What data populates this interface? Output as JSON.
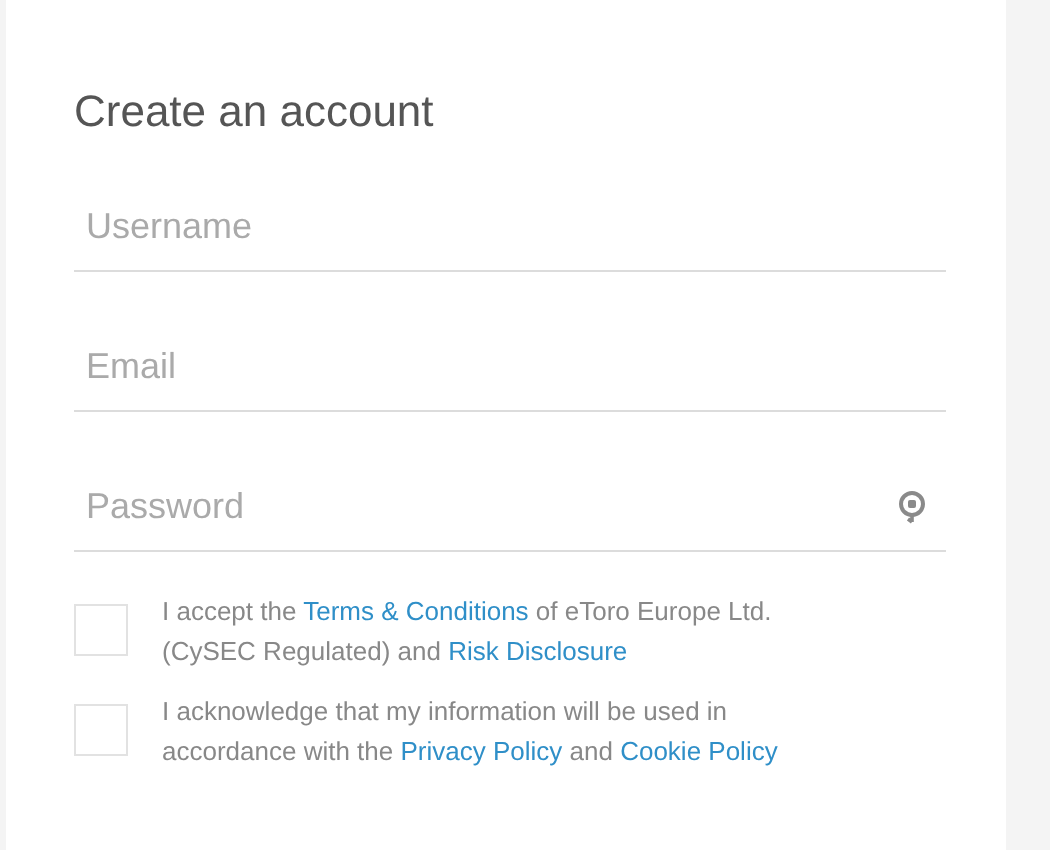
{
  "title": "Create an account",
  "fields": [
    {
      "placeholder": "Username",
      "kind": "text"
    },
    {
      "placeholder": "Email",
      "kind": "email"
    },
    {
      "placeholder": "Password",
      "kind": "password"
    }
  ],
  "consents": [
    {
      "checked": false,
      "parts": [
        {
          "kind": "text",
          "text": "I accept the "
        },
        {
          "kind": "link",
          "text": "Terms & Conditions"
        },
        {
          "kind": "text",
          "text": " of eToro Europe Ltd. (CySEC Regulated) and "
        },
        {
          "kind": "link",
          "text": "Risk Disclosure"
        }
      ]
    },
    {
      "checked": false,
      "parts": [
        {
          "kind": "text",
          "text": "I acknowledge that my information will be used in accordance with the "
        },
        {
          "kind": "link",
          "text": "Privacy Policy"
        },
        {
          "kind": "text",
          "text": " and "
        },
        {
          "kind": "link",
          "text": "Cookie Policy"
        }
      ]
    }
  ]
}
